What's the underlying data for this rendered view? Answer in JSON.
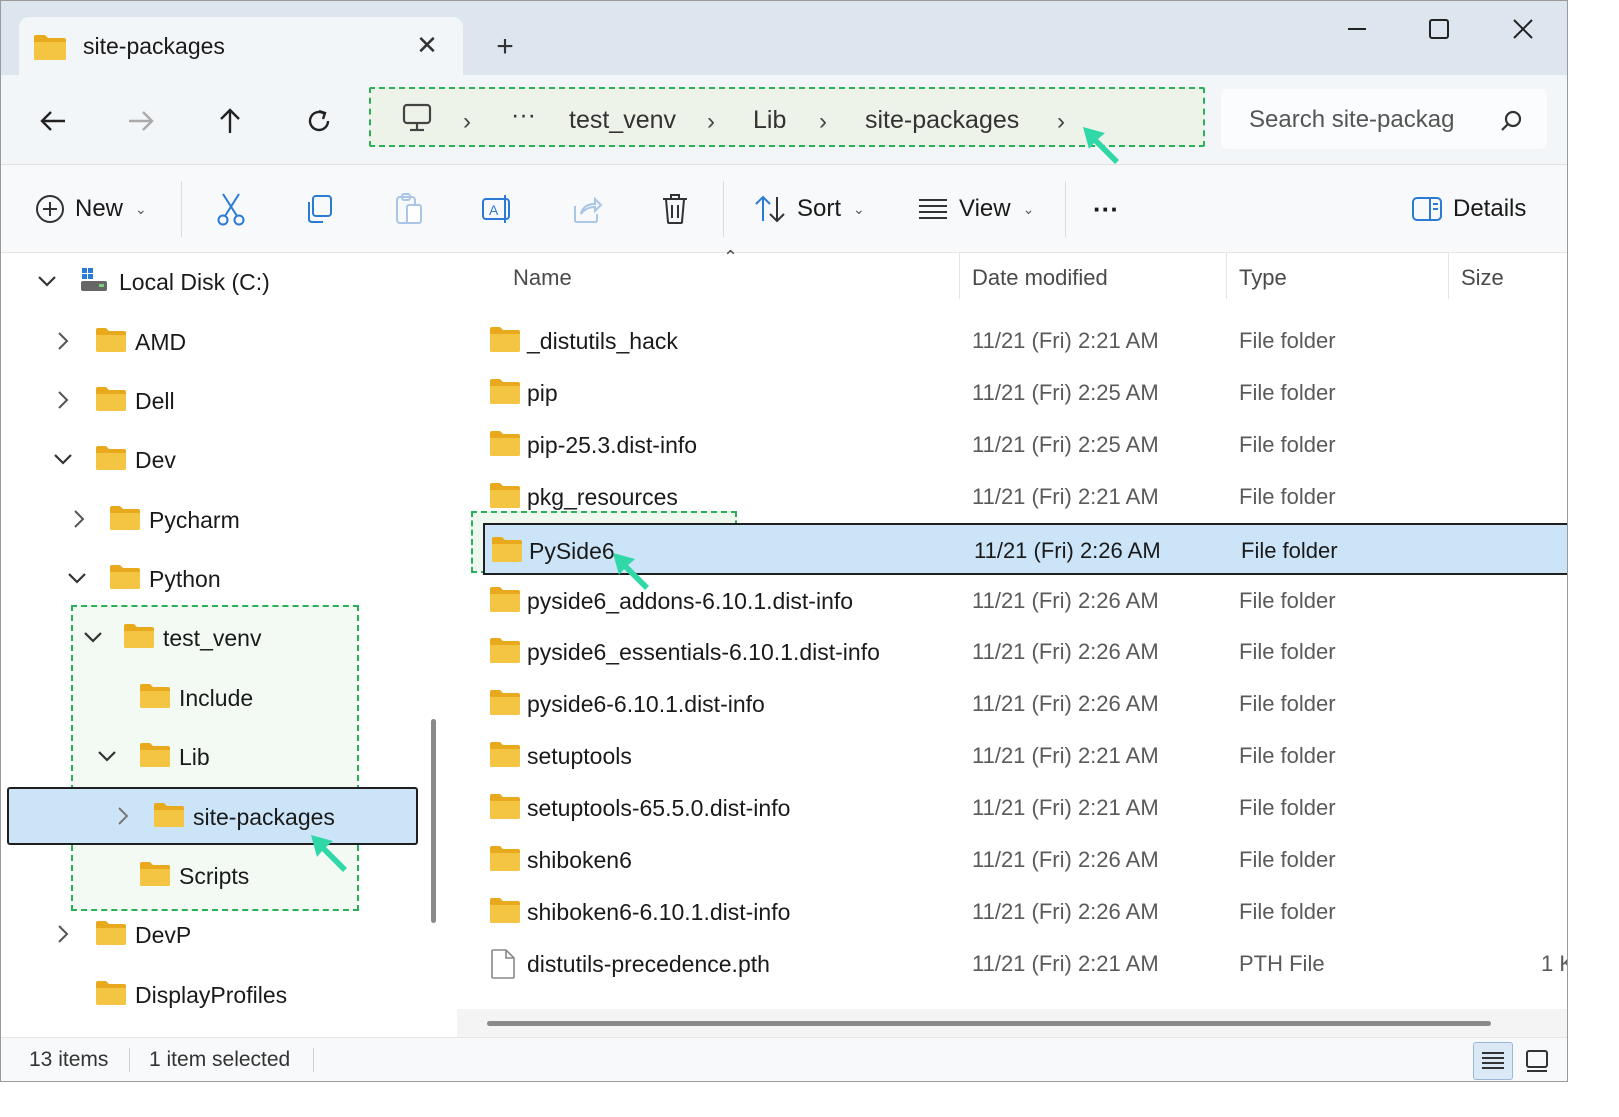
{
  "window": {
    "tab_title": "site-packages",
    "new_tab_symbol": "+"
  },
  "address": {
    "crumbs": [
      "test_venv",
      "Lib",
      "site-packages"
    ],
    "ellipsis": "···"
  },
  "search": {
    "placeholder": "Search site-packag"
  },
  "toolbar": {
    "new_label": "New",
    "sort_label": "Sort",
    "view_label": "View",
    "more_label": "···",
    "details_label": "Details"
  },
  "sidebar": {
    "items": [
      {
        "label": "Local Disk (C:)"
      },
      {
        "label": "AMD"
      },
      {
        "label": "Dell"
      },
      {
        "label": "Dev"
      },
      {
        "label": "Pycharm"
      },
      {
        "label": "Python"
      },
      {
        "label": "test_venv"
      },
      {
        "label": "Include"
      },
      {
        "label": "Lib"
      },
      {
        "label": "site-packages",
        "selected": true
      },
      {
        "label": "Scripts"
      },
      {
        "label": "DevP"
      },
      {
        "label": "DisplayProfiles"
      }
    ]
  },
  "columns": {
    "name": "Name",
    "date": "Date modified",
    "type": "Type",
    "size": "Size"
  },
  "files": [
    {
      "name": "_distutils_hack",
      "date": "11/21 (Fri) 2:21 AM",
      "type": "File folder",
      "size": ""
    },
    {
      "name": "pip",
      "date": "11/21 (Fri) 2:25 AM",
      "type": "File folder",
      "size": ""
    },
    {
      "name": "pip-25.3.dist-info",
      "date": "11/21 (Fri) 2:25 AM",
      "type": "File folder",
      "size": ""
    },
    {
      "name": "pkg_resources",
      "date": "11/21 (Fri) 2:21 AM",
      "type": "File folder",
      "size": ""
    },
    {
      "name": "PySide6",
      "date": "11/21 (Fri) 2:26 AM",
      "type": "File folder",
      "size": "",
      "selected": true
    },
    {
      "name": "pyside6_addons-6.10.1.dist-info",
      "date": "11/21 (Fri) 2:26 AM",
      "type": "File folder",
      "size": ""
    },
    {
      "name": "pyside6_essentials-6.10.1.dist-info",
      "date": "11/21 (Fri) 2:26 AM",
      "type": "File folder",
      "size": ""
    },
    {
      "name": "pyside6-6.10.1.dist-info",
      "date": "11/21 (Fri) 2:26 AM",
      "type": "File folder",
      "size": ""
    },
    {
      "name": "setuptools",
      "date": "11/21 (Fri) 2:21 AM",
      "type": "File folder",
      "size": ""
    },
    {
      "name": "setuptools-65.5.0.dist-info",
      "date": "11/21 (Fri) 2:21 AM",
      "type": "File folder",
      "size": ""
    },
    {
      "name": "shiboken6",
      "date": "11/21 (Fri) 2:26 AM",
      "type": "File folder",
      "size": ""
    },
    {
      "name": "shiboken6-6.10.1.dist-info",
      "date": "11/21 (Fri) 2:26 AM",
      "type": "File folder",
      "size": ""
    },
    {
      "name": "distutils-precedence.pth",
      "date": "11/21 (Fri) 2:21 AM",
      "type": "PTH File",
      "size": "1 K",
      "is_file": true
    }
  ],
  "status": {
    "count": "13 items",
    "selection": "1 item selected"
  },
  "colors": {
    "folder": "#f4c542",
    "folder_dark": "#e8a91c",
    "selection": "#cce4f7",
    "highlight_border": "#2bb05a",
    "cursor": "#2fd8a6"
  },
  "icons": [
    "folder-icon",
    "back-arrow-icon",
    "forward-arrow-icon",
    "up-arrow-icon",
    "refresh-icon",
    "computer-icon",
    "search-icon",
    "plus-circle-icon",
    "cut-icon",
    "copy-icon",
    "paste-icon",
    "rename-icon",
    "share-icon",
    "delete-icon",
    "sort-icon",
    "view-icon",
    "details-pane-icon",
    "drive-icon",
    "file-icon",
    "cursor-arrow-icon"
  ]
}
